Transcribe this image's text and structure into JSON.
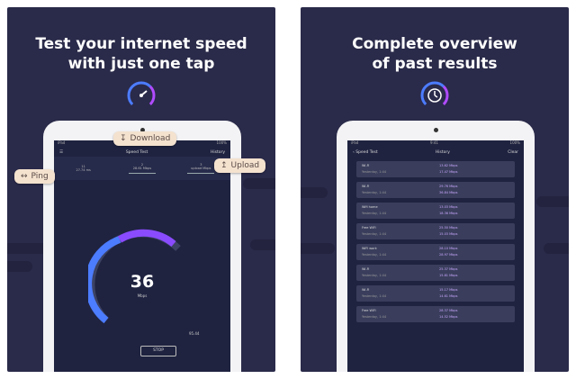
{
  "left": {
    "headline_line1": "Test your internet speed",
    "headline_line2": "with just one tap",
    "icon": "speedometer-icon",
    "status": {
      "carrier": "iPad",
      "time": "9:41",
      "battery": "100%"
    },
    "nav": {
      "title": "Speed Test",
      "right": "History"
    },
    "tabs": [
      {
        "value": "11",
        "label": "27.74 ms"
      },
      {
        "value": "2",
        "label": "28.61 Mbps"
      },
      {
        "value": "3",
        "label": "upload Mbps"
      }
    ],
    "speed_value": "36",
    "speed_unit": "Mbps",
    "ping_value": "95.44",
    "stop_label": "STOP",
    "pills": {
      "download": "Download",
      "upload": "Upload",
      "ping": "Ping"
    }
  },
  "right": {
    "headline_line1": "Complete overview",
    "headline_line2": "of past results",
    "icon": "history-clock-icon",
    "nav": {
      "back": "Speed Test",
      "title": "History",
      "right": "Clear"
    },
    "rows": [
      {
        "name": "Wi-Fi",
        "sub": "Yesterday, 1:44",
        "dl": "13.62 Mbps",
        "ul": "17.47 Mbps"
      },
      {
        "name": "Wi-Fi",
        "sub": "Yesterday, 1:44",
        "dl": "29.76 Mbps",
        "ul": "36.84 Mbps"
      },
      {
        "name": "Wifi home",
        "sub": "Yesterday, 1:44",
        "dl": "13.03 Mbps",
        "ul": "18.36 Mbps"
      },
      {
        "name": "Free WiFi",
        "sub": "Yesterday, 1:44",
        "dl": "25.50 Mbps",
        "ul": "15.03 Mbps"
      },
      {
        "name": "WiFi work",
        "sub": "Yesterday, 1:44",
        "dl": "28.10 Mbps",
        "ul": "28.97 Mbps"
      },
      {
        "name": "Wi-Fi",
        "sub": "Yesterday, 1:44",
        "dl": "25.37 Mbps",
        "ul": "15.81 Mbps"
      },
      {
        "name": "Wi-Fi",
        "sub": "Yesterday, 1:44",
        "dl": "15.17 Mbps",
        "ul": "14.61 Mbps"
      },
      {
        "name": "Free WiFi",
        "sub": "Yesterday, 1:44",
        "dl": "28.37 Mbps",
        "ul": "14.52 Mbps"
      }
    ]
  },
  "colors": {
    "panel": "#2a2a4a",
    "accent": "#8a4bff",
    "pill": "#f4e2cf"
  }
}
